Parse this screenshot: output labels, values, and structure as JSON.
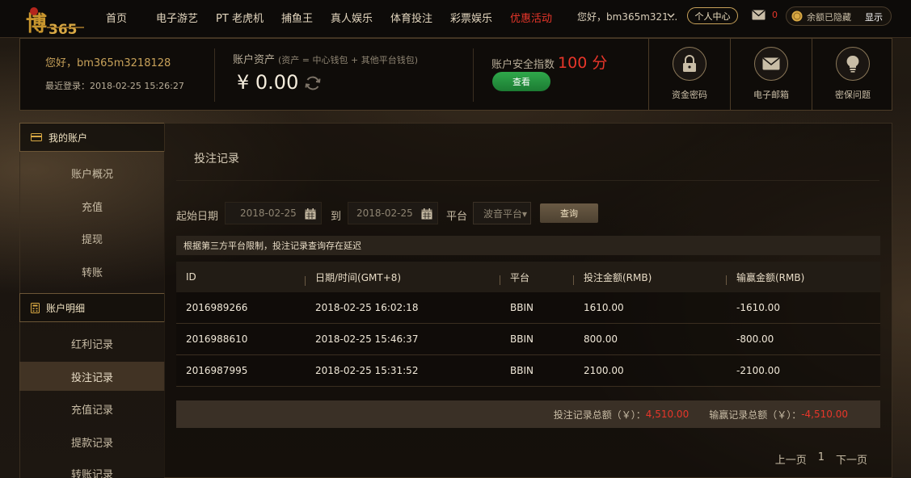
{
  "header": {
    "nav": [
      "首页",
      "电子游艺",
      "PT 老虎机",
      "捕鱼王",
      "真人娱乐",
      "体育投注",
      "彩票娱乐",
      "优惠活动"
    ],
    "greeting": "您好，bm365m321...",
    "center_btn": "个人中心",
    "mail_count": "0",
    "balance_hidden": "余额已隐藏",
    "show_btn": "显示",
    "logo_text": "博365"
  },
  "account": {
    "greeting": "您好，bm365m3218128",
    "last_login": "最近登录：2018-02-25 15:26:27",
    "asset_title": "账户资产",
    "asset_sub": "(资产 = 中心钱包 + 其他平台钱包)",
    "asset_value": "¥ 0.00",
    "security_title": "账户安全指数",
    "security_score": "100 分",
    "view_btn": "查看",
    "tiles": [
      "资金密码",
      "电子邮箱",
      "密保问题"
    ]
  },
  "sidebar": {
    "group1": "我的账户",
    "group1_items": [
      "账户概况",
      "充值",
      "提现",
      "转账"
    ],
    "group2": "账户明细",
    "group2_items": [
      "红利记录",
      "投注记录",
      "充值记录",
      "提款记录",
      "转账记录"
    ]
  },
  "main": {
    "title": "投注记录",
    "start_label": "起始日期",
    "start_date": "2018-02-25",
    "to_label": "到",
    "end_date": "2018-02-25",
    "platform_label": "平台",
    "platform_value": "波音平台",
    "query_btn": "查询",
    "notice": "根据第三方平台限制，投注记录查询存在延迟",
    "columns": [
      "ID",
      "日期/时间(GMT+8)",
      "平台",
      "投注金额(RMB)",
      "输赢金额(RMB)"
    ],
    "rows": [
      [
        "2016989266",
        "2018-02-25 16:02:18",
        "BBIN",
        "1610.00",
        "-1610.00"
      ],
      [
        "2016988610",
        "2018-02-25 15:46:37",
        "BBIN",
        "800.00",
        "-800.00"
      ],
      [
        "2016987995",
        "2018-02-25 15:31:52",
        "BBIN",
        "2100.00",
        "-2100.00"
      ]
    ],
    "bet_total_label": "投注记录总额（￥）：",
    "bet_total": "4,510.00",
    "win_total_label": "输赢记录总额（￥）：",
    "win_total": "-4,510.00",
    "pager": {
      "prev": "上一页",
      "page": "1",
      "next": "下一页"
    }
  }
}
